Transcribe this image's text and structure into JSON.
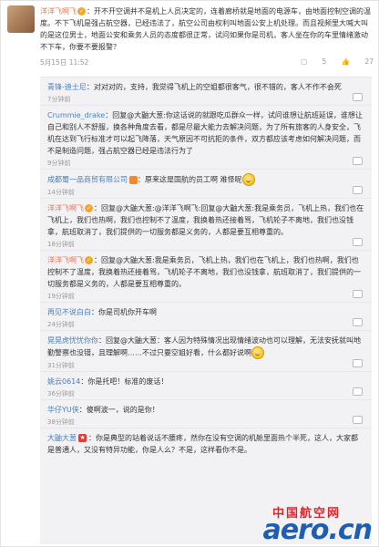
{
  "post": {
    "author": "洋洋飞啊飞",
    "text": "：开不开空调并不是机上人员决定的，连着廊桥就是地面的电源车，由地面控制空调的温度。不下飞机是强占航空器，已经违法了，航空公司由权利叫地面公安上机处理。而且视频里大喊大叫的是这位男士，地面公安和乘务人员的态度都很正常，试问如果你是司机，客人坐在你的车里情绪激动不下车，你要不要报警？",
    "time": "5月15日 11:52",
    "reply_count": "5",
    "like_count": "27"
  },
  "comments": [
    {
      "author": "青锋-迪士尼",
      "text": "：对对对的，支持，我觉得飞机上的空姐都很客气，很不错的，客人不作不会死",
      "time": "7分钟前"
    },
    {
      "author": "Crummie_drake",
      "text": "：回复@大鼬大葱:你这话说的就跟吃瓜群众一样，试问谁想让航班延误，谁想让自己和别人不舒服，换各种角度去看，都是尽最大能力去解决问题，为了所有旅客的人身安全，飞机在达到飞行标准才可以起飞降落，天气原因不可抗拒的条件，双方都应该考虑如何解决问题，而不是制造问题，强占航空器已经是违法行为了",
      "time": "9分钟前"
    },
    {
      "author": "成都蜀一品商贸有限公司",
      "text": "：原来这是国航的员工啊  难怪呢",
      "time": "14分钟前"
    },
    {
      "author": "洋洋飞啊飞",
      "text": "：回复@大鼬大葱:@洋洋飞啊飞:回复@大鼬大葱:我是乘务员，飞机上热，我们也在飞机上，我们也热啊，我们也控制不了温度，我换着热还接着骂，飞机轮子不离地，我们也没钱拿，航班取消了，我们提供的一切服务都是义务的，人都是要互相尊重的。",
      "time": "18分钟前"
    },
    {
      "author": "洋洋飞啊飞",
      "text": "：回复@大鼬大葱:我是乘务员，飞机上热，我们也在飞机上，我们也热啊，我们也控制不了温度，我换着热还接着骂，飞机轮子不离地，我们也没钱拿，航班取消了，我们提供的一切服务都是义务的，人都是要互相尊重的。",
      "time": "19分钟前"
    },
    {
      "author": "再见不说白白",
      "text": "：你是司机你开车啊",
      "time": "24分钟前"
    },
    {
      "author": "晃晃虎忧忧你你",
      "text": "：回复@大鼬大葱：客人因为特殊情况出现情绪波动也可以理解，无法安抚就叫地勤警察也没错，且理解啊……不过只要空姐好看，什么都好说啊",
      "time": "31分钟前"
    },
    {
      "author": "姚云0614",
      "text": "：你是托吧！标准的废话！",
      "time": "36分钟前"
    },
    {
      "author": "华仔YU侠",
      "text": "：傻啊波一，说的是你！",
      "time": "38分钟前"
    },
    {
      "author": "大鼬大葱",
      "text": "：你是典型的站着说话不腰疼，然你在没有空调的机舱里面热个半死，这人，大家都是普通人，又没有特异功能，你是人么？不是，这样看你不是。"
    }
  ],
  "watermark": {
    "cn": "中国航空网",
    "en": "aero.cn"
  },
  "colors": {
    "author_orange": "#eb7350",
    "author_blue": "#4a7fba",
    "panel_bg": "#f2f2f5"
  }
}
